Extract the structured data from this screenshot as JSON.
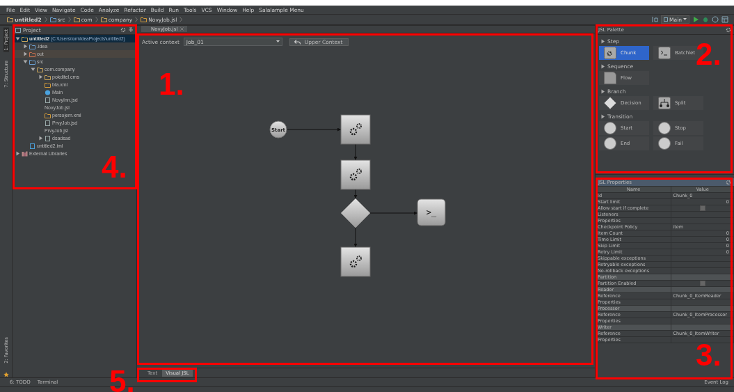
{
  "menu": [
    "File",
    "Edit",
    "View",
    "Navigate",
    "Code",
    "Analyze",
    "Refactor",
    "Build",
    "Run",
    "Tools",
    "VCS",
    "Window",
    "Help",
    "Salalample Menu"
  ],
  "breadcrumbs": [
    {
      "label": "untitled2",
      "kind": "module"
    },
    {
      "label": "src",
      "kind": "folder"
    },
    {
      "label": "com",
      "kind": "package"
    },
    {
      "label": "company",
      "kind": "package"
    },
    {
      "label": "NovyJob.jsl",
      "kind": "xml"
    }
  ],
  "run_config": "Main",
  "side_tabs": [
    {
      "label": "1: Project",
      "selected": true
    },
    {
      "label": "7: Structure",
      "selected": false
    }
  ],
  "favorites_tab": "2: Favorites",
  "project": {
    "title": "Project",
    "tree": [
      {
        "label": "untitled2",
        "detail": "(C:\\Users\\tom\\IdeaProjects\\untitled2)",
        "kind": "module",
        "expanded": true,
        "selected": true,
        "children": [
          {
            "label": ".idea",
            "kind": "folder",
            "expanded": false,
            "selected": false
          },
          {
            "label": "out",
            "kind": "folder-excluded",
            "expanded": false,
            "selected": false
          },
          {
            "label": "src",
            "kind": "folder",
            "expanded": true,
            "selected": false,
            "children": [
              {
                "label": "com.company",
                "kind": "package",
                "expanded": true,
                "selected": false,
                "children": [
                  {
                    "label": "pokditel.cms",
                    "kind": "package",
                    "expanded": false,
                    "selected": false
                  },
                  {
                    "label": "bla.xml",
                    "kind": "xml",
                    "selected": false
                  },
                  {
                    "label": "Main",
                    "kind": "class",
                    "selected": false
                  },
                  {
                    "label": "NovyInn.jsd",
                    "kind": "file",
                    "selected": false
                  },
                  {
                    "label": "NovyJob.jsl",
                    "kind": "plain",
                    "selected": false
                  },
                  {
                    "label": "persojem.xml",
                    "kind": "xml",
                    "selected": false
                  },
                  {
                    "label": "PrvyJob.jsd",
                    "kind": "file",
                    "selected": false
                  },
                  {
                    "label": "PrvyJob.jsl",
                    "kind": "plain",
                    "selected": false
                  },
                  {
                    "label": "dsadsad",
                    "kind": "file",
                    "expanded": false,
                    "selected": false
                  }
                ]
              }
            ]
          },
          {
            "label": "untitled2.iml",
            "kind": "module-file",
            "selected": false
          }
        ]
      },
      {
        "label": "External Libraries",
        "kind": "library",
        "expanded": false,
        "selected": false
      }
    ]
  },
  "editor": {
    "tab": "NovyJob.jsl",
    "context_label": "Active context",
    "context_value": "Job_01",
    "upper_button": "Upper Context",
    "nodes": [
      {
        "kind": "start",
        "label": "Start"
      },
      {
        "kind": "chunk"
      },
      {
        "kind": "chunk"
      },
      {
        "kind": "decision"
      },
      {
        "kind": "batchlet",
        "label": ">_"
      },
      {
        "kind": "chunk"
      }
    ],
    "bottom_tabs": [
      {
        "label": "Text",
        "selected": false
      },
      {
        "label": "Visual JSL",
        "selected": true
      }
    ]
  },
  "palette": {
    "title": "JSL Palette",
    "groups": [
      {
        "name": "Step",
        "items": [
          {
            "label": "Chunk",
            "kind": "chunk",
            "selected": true
          },
          {
            "label": "Batchlet",
            "kind": "batchlet",
            "selected": false
          }
        ]
      },
      {
        "name": "Sequence",
        "items": [
          {
            "label": "Flow",
            "kind": "flow",
            "selected": false
          }
        ]
      },
      {
        "name": "Branch",
        "items": [
          {
            "label": "Decision",
            "kind": "decision",
            "selected": false
          },
          {
            "label": "Split",
            "kind": "split",
            "selected": false
          }
        ]
      },
      {
        "name": "Transition",
        "items": [
          {
            "label": "Start",
            "kind": "start",
            "selected": false
          },
          {
            "label": "Stop",
            "kind": "stop",
            "selected": false
          },
          {
            "label": "End",
            "kind": "end",
            "selected": false
          },
          {
            "label": "Fail",
            "kind": "fail",
            "selected": false
          }
        ]
      }
    ]
  },
  "properties": {
    "title": "JSL Properties",
    "columns": [
      "Name",
      "Value"
    ],
    "rows": [
      {
        "kind": "row",
        "name": "Id",
        "value": "Chunk_0"
      },
      {
        "kind": "number",
        "name": "Start limit",
        "value": "0"
      },
      {
        "kind": "checkbox",
        "name": "Allow start if complete",
        "checked": false
      },
      {
        "kind": "row",
        "name": "Listeners"
      },
      {
        "kind": "row",
        "name": "Properties"
      },
      {
        "kind": "row",
        "name": "Checkpoint Policy",
        "value": "item"
      },
      {
        "kind": "number",
        "name": "Item Count",
        "value": "0"
      },
      {
        "kind": "number",
        "name": "Time Limit",
        "value": "0"
      },
      {
        "kind": "number",
        "name": "Skip Limit",
        "value": "0"
      },
      {
        "kind": "number",
        "name": "Retry Limit",
        "value": "0"
      },
      {
        "kind": "row",
        "name": "Skippable exceptions"
      },
      {
        "kind": "row",
        "name": "Retryable exceptions"
      },
      {
        "kind": "row",
        "name": "No-rollback exceptions"
      },
      {
        "kind": "section",
        "name": "Partition"
      },
      {
        "kind": "checkbox",
        "name": "Partition Enabled",
        "checked": false
      },
      {
        "kind": "section",
        "name": "Reader"
      },
      {
        "kind": "row",
        "name": "Reference",
        "value": "Chunk_0_ItemReader"
      },
      {
        "kind": "row",
        "name": "Properties"
      },
      {
        "kind": "section",
        "name": "Processor"
      },
      {
        "kind": "row",
        "name": "Reference",
        "value": "Chunk_0_ItemProcessor"
      },
      {
        "kind": "row",
        "name": "Properties"
      },
      {
        "kind": "section",
        "name": "Writer"
      },
      {
        "kind": "row",
        "name": "Reference",
        "value": "Chunk_0_ItemWriter"
      },
      {
        "kind": "row",
        "name": "Properties"
      }
    ]
  },
  "tool_windows": [
    "6: TODO",
    "Terminal"
  ],
  "event_log": "Event Log",
  "annotations": [
    "1.",
    "2.",
    "3.",
    "4.",
    "5."
  ]
}
